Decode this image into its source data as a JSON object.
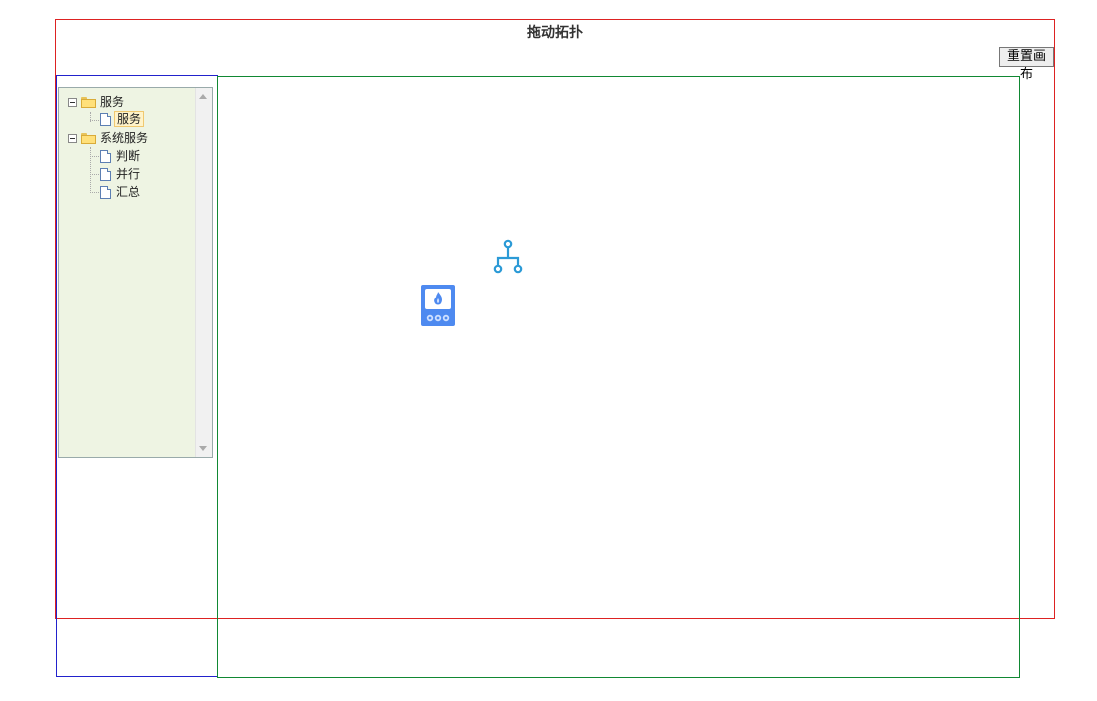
{
  "page": {
    "title": "拖动拓扑",
    "reset_label": "重置画布"
  },
  "tree": {
    "nodes": [
      {
        "label": "服务",
        "type": "folder",
        "expanded": true
      },
      {
        "label": "服务",
        "type": "leaf",
        "selected": true
      },
      {
        "label": "系统服务",
        "type": "folder",
        "expanded": true
      },
      {
        "label": "判断",
        "type": "leaf"
      },
      {
        "label": "并行",
        "type": "leaf"
      },
      {
        "label": "汇总",
        "type": "leaf"
      }
    ]
  },
  "canvas": {
    "nodes": [
      {
        "icon": "topology-icon",
        "color": "#2b9ad6"
      },
      {
        "icon": "heater-device-icon",
        "color": "#4e8af0"
      }
    ]
  },
  "colors": {
    "outer_border": "#dd2222",
    "left_border": "#2222cc",
    "canvas_border": "#118833",
    "tree_background": "#eef4e3"
  }
}
